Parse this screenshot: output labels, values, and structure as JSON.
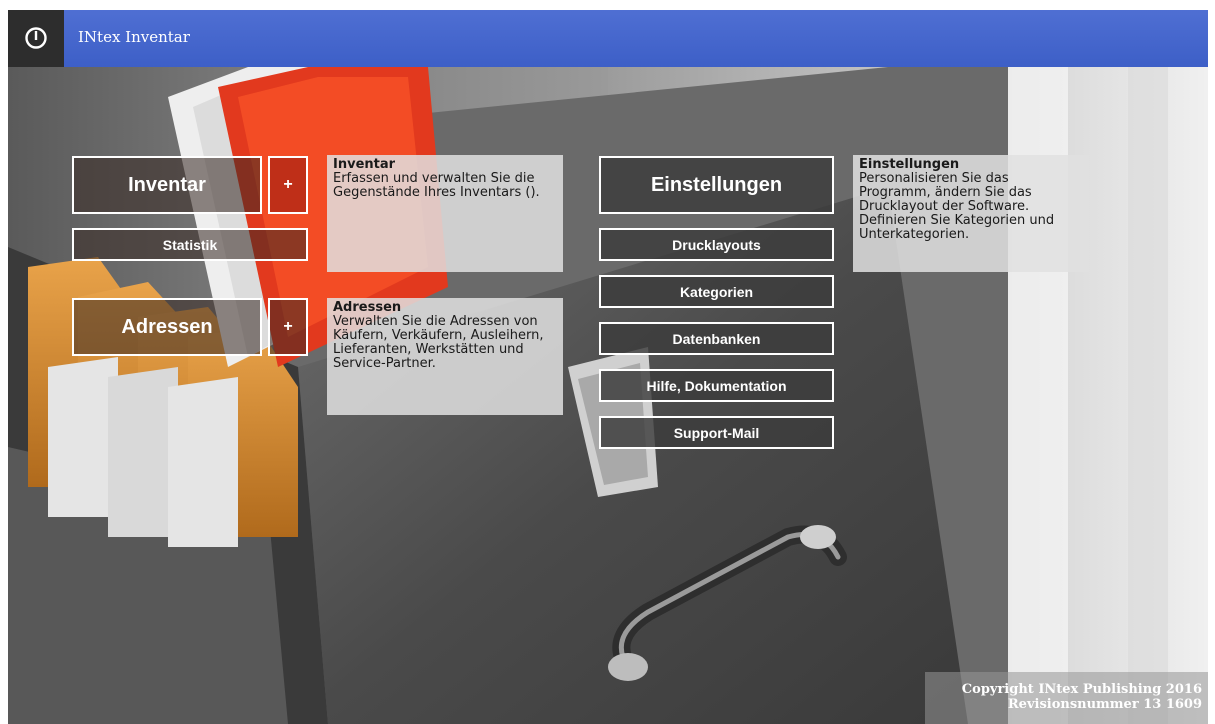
{
  "window": {
    "title": "INtex Inventar",
    "power_icon": "power-icon"
  },
  "left": {
    "inventar_button": "Inventar",
    "inventar_add": "+",
    "statistik_button": "Statistik",
    "adressen_button": "Adressen",
    "adressen_add": "+"
  },
  "info_inventar": {
    "heading": "Inventar",
    "text": "Erfassen und verwalten Sie die Gegenstände Ihres Inventars ()."
  },
  "info_adressen": {
    "heading": "Adressen",
    "text": "Verwalten Sie die Adressen von Käufern, Verkäufern, Ausleihern, Lieferanten, Werkstätten und Service-Partner."
  },
  "right": {
    "einstellungen_button": "Einstellungen",
    "drucklayouts_button": "Drucklayouts",
    "kategorien_button": "Kategorien",
    "datenbanken_button": "Datenbanken",
    "hilfe_button": "Hilfe, Dokumentation",
    "support_button": "Support-Mail"
  },
  "info_einstellungen": {
    "heading": "Einstellungen",
    "text": "Personalisieren Sie das Programm, ändern Sie das Drucklayout der Software. Definieren Sie Kategorien und Unterkategorien."
  },
  "footer": {
    "copyright": "Copyright INtex Publishing 2016",
    "revision": "Revisionsnummer 13 1609"
  },
  "colors": {
    "titlebar": "#4466cc",
    "accent_red": "#c0391b",
    "folder_orange": "#d88a2c"
  }
}
